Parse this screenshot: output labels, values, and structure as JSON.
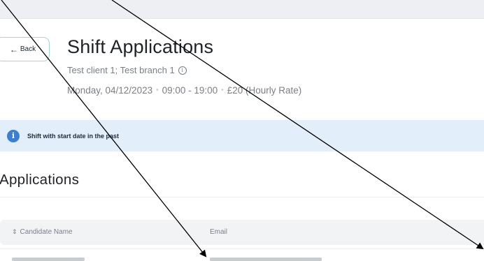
{
  "header": {
    "back_label": "Back",
    "title": "Shift Applications",
    "subtitle": "Test client 1; Test branch 1",
    "date": "Monday, 04/12/2023",
    "time": "09:00 - 19:00",
    "rate": "£20 (Hourly Rate)"
  },
  "alert": {
    "text": "Shift with start date in the past",
    "icon": "info-icon",
    "color": "#3a7fd5"
  },
  "applications": {
    "section_title": "Applications",
    "columns": [
      "Candidate Name",
      "Email"
    ]
  },
  "colors": {
    "back_border": "#9fd8d0",
    "alert_bg": "#e3eefb"
  }
}
